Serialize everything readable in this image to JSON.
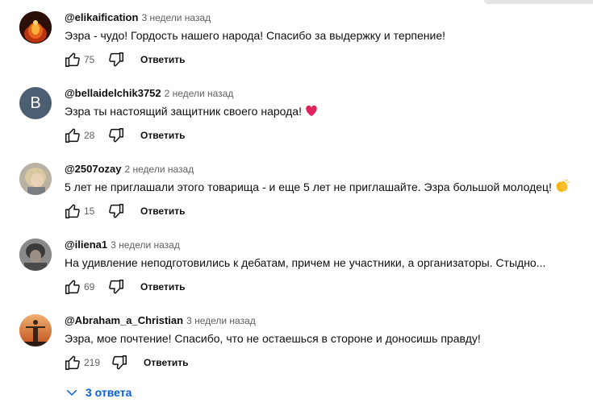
{
  "comments": [
    {
      "author": "@elikaification",
      "time": "3 недели назад",
      "text": "Эзра - чудо! Гордость нашего народа! Спасибо за выдержку и терпение!",
      "likes": "75",
      "reply_label": "Ответить",
      "avatar_icon": "fire-avatar"
    },
    {
      "author": "@bellaidelchik3752",
      "time": "2 недели назад",
      "text": "Эзра ты настоящий защитник своего народа!",
      "likes": "28",
      "reply_label": "Ответить",
      "avatar_letter": "B",
      "avatar_color": "#4b5e72",
      "emoji_icon": "red-heart-icon"
    },
    {
      "author": "@2507ozay",
      "time": "2 недели назад",
      "text": "5 лет не приглашали этого товарища - и еще 5 лет не приглашайте. Эзра большой молодец!",
      "likes": "15",
      "reply_label": "Ответить",
      "avatar_icon": "photo-avatar",
      "emoji_icon": "clapping-hands-icon"
    },
    {
      "author": "@iliena1",
      "time": "3 недели назад",
      "text": "На удивление неподготовились к дебатам, причем не участники, а организаторы. Стыдно...",
      "likes": "69",
      "reply_label": "Ответить",
      "avatar_icon": "photo-avatar"
    },
    {
      "author": "@Abraham_a_Christian",
      "time": "3 недели назад",
      "text": "Эзра, мое почтение! Спасибо, что не остаешься в стороне и доносишь правду!",
      "likes": "219",
      "reply_label": "Ответить",
      "avatar_icon": "statue-avatar"
    }
  ],
  "replies_toggle": {
    "label": "3 ответа",
    "icon": "chevron-down-icon"
  },
  "colors": {
    "link_blue": "#065fd4",
    "meta_gray": "#606060",
    "heart_red": "#e0245e"
  }
}
